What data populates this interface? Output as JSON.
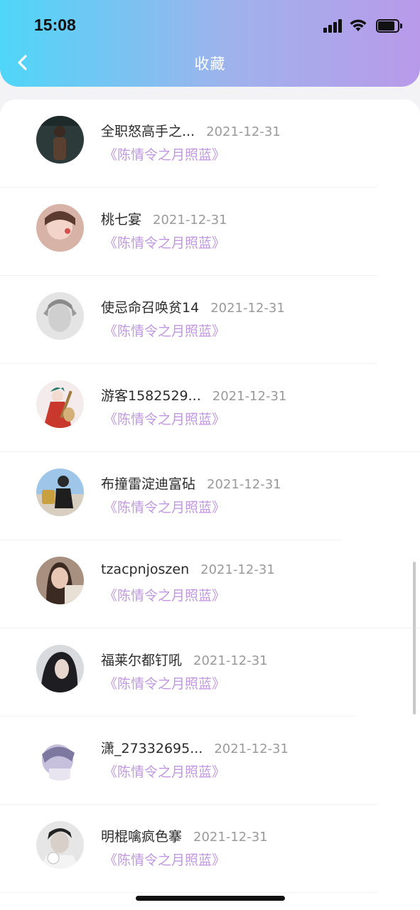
{
  "status_bar": {
    "time": "15:08"
  },
  "header": {
    "title": "收藏",
    "back_icon": "chevron-left-icon"
  },
  "items": [
    {
      "name": "全职怒高手之...",
      "date": "2021-12-31",
      "work": "《陈情令之月照蓝》",
      "avatar_color": "#4a3a2e"
    },
    {
      "name": "桃七宴",
      "date": "2021-12-31",
      "work": "《陈情令之月照蓝》",
      "avatar_color": "#d9a89a"
    },
    {
      "name": "使忌命召唤贫14",
      "date": "2021-12-31",
      "work": "《陈情令之月照蓝》",
      "avatar_color": "#b8b8b8"
    },
    {
      "name": "游客1582529...",
      "date": "2021-12-31",
      "work": "《陈情令之月照蓝》",
      "avatar_color": "#c84a3c"
    },
    {
      "name": "布撞雷淀迪富砧",
      "date": "2021-12-31",
      "work": "《陈情令之月照蓝》",
      "avatar_color": "#5a7a9a"
    },
    {
      "name": "tzacpnjoszen",
      "date": "2021-12-31",
      "work": "《陈情令之月照蓝》",
      "avatar_color": "#8a6a5a"
    },
    {
      "name": "福莱尔都钉吼",
      "date": "2021-12-31",
      "work": "《陈情令之月照蓝》",
      "avatar_color": "#3a3a3e"
    },
    {
      "name": "潇_27332695...",
      "date": "2021-12-31",
      "work": "《陈情令之月照蓝》",
      "avatar_color": "#b8b0d0"
    },
    {
      "name": "明棍噙疯色搴",
      "date": "2021-12-31",
      "work": "《陈情令之月照蓝》",
      "avatar_color": "#6a6a6a"
    }
  ],
  "colors": {
    "header_gradient_start": "#4fd6f8",
    "header_gradient_end": "#b99aea",
    "work_title": "#c097e2",
    "date": "#9a9a9a"
  }
}
